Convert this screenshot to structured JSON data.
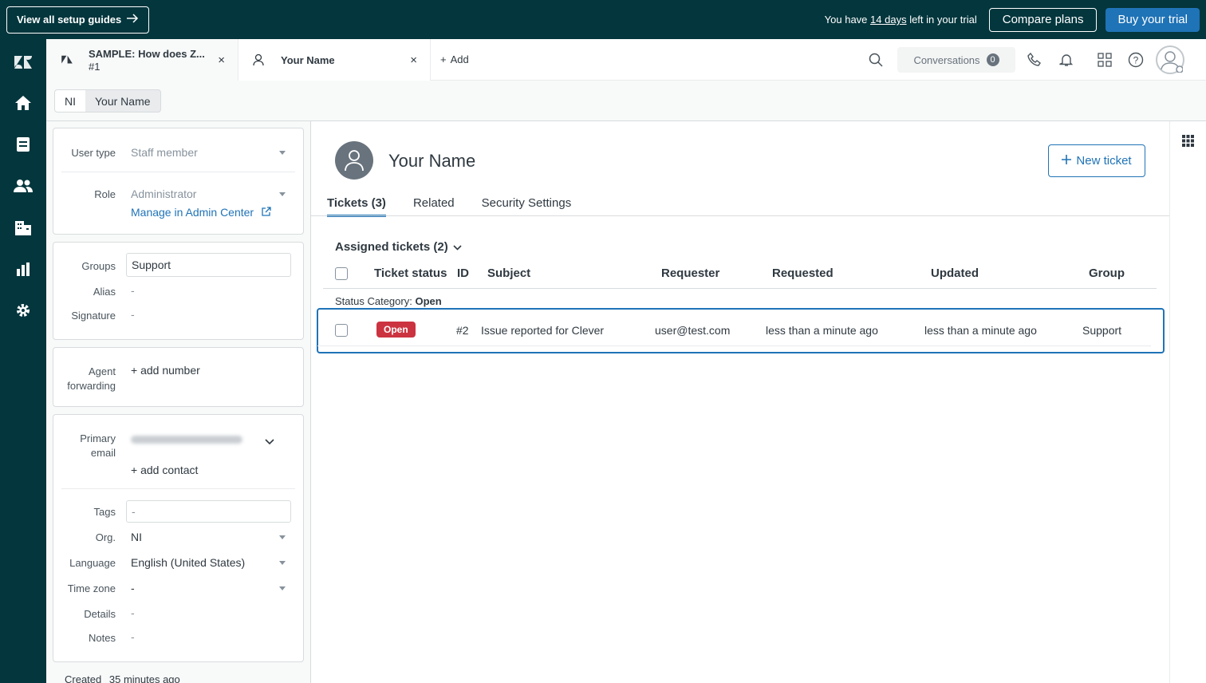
{
  "topbar": {
    "guides_label": "View all setup guides",
    "trial_prefix": "You have ",
    "trial_days": "14 days",
    "trial_suffix": " left in your trial",
    "compare_label": "Compare plans",
    "buy_label": "Buy your trial"
  },
  "tabs": [
    {
      "title": "SAMPLE: How does Z...",
      "subtitle": "#1",
      "close": "×"
    },
    {
      "title": "Your Name",
      "close": "×"
    }
  ],
  "add_tab_label": "Add",
  "header": {
    "conversations_label": "Conversations",
    "conversations_count": "0"
  },
  "breadcrumb": [
    "NI",
    "Your Name"
  ],
  "user_fields": {
    "user_type_label": "User type",
    "user_type_value": "Staff member",
    "role_label": "Role",
    "role_value": "Administrator",
    "manage_link": "Manage in Admin Center",
    "groups_label": "Groups",
    "groups_value": "Support",
    "alias_label": "Alias",
    "alias_value": "-",
    "signature_label": "Signature",
    "signature_value": "-",
    "agent_forwarding_label_1": "Agent",
    "agent_forwarding_label_2": "forwarding",
    "add_number": "+ add number",
    "primary_email_label_1": "Primary",
    "primary_email_label_2": "email",
    "add_contact": "+ add contact",
    "tags_label": "Tags",
    "tags_value": "-",
    "org_label": "Org.",
    "org_value": "NI",
    "language_label": "Language",
    "language_value": "English (United States)",
    "timezone_label": "Time zone",
    "timezone_value": "-",
    "details_label": "Details",
    "details_value": "-",
    "notes_label": "Notes",
    "notes_value": "-",
    "created_label": "Created",
    "created_value": "35 minutes ago"
  },
  "profile": {
    "name": "Your Name",
    "new_ticket_label": "New ticket"
  },
  "main_tabs": [
    "Tickets (3)",
    "Related",
    "Security Settings"
  ],
  "tickets": {
    "section_title": "Assigned tickets (2)",
    "columns": [
      "Ticket status",
      "ID",
      "Subject",
      "Requester",
      "Requested",
      "Updated",
      "Group"
    ],
    "status_category_prefix": "Status Category: ",
    "status_category_value": "Open",
    "rows": [
      {
        "status": "Open",
        "id": "#2",
        "subject": "Issue reported for Clever",
        "requester": "user@test.com",
        "requested": "less than a minute ago",
        "updated": "less than a minute ago",
        "group": "Support"
      }
    ]
  },
  "colors": {
    "brand_dark": "#03363d",
    "accent_blue": "#1f73b7",
    "open_badge": "#cc3340"
  }
}
